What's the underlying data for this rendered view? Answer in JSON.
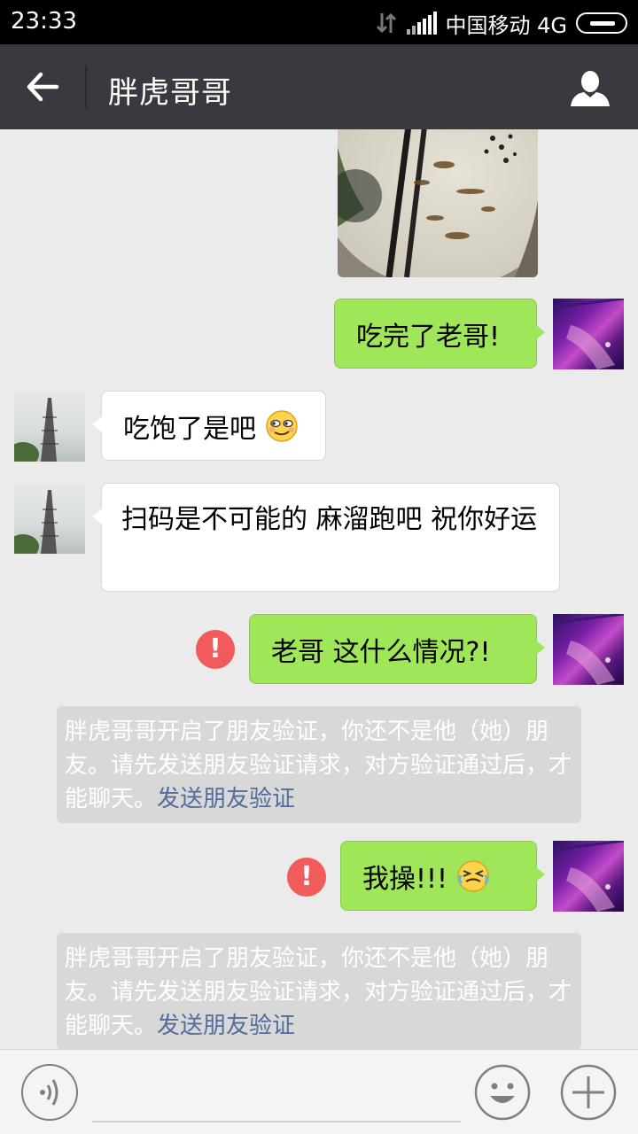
{
  "status_bar": {
    "time": "23:33",
    "carrier": "中国移动 4G"
  },
  "header": {
    "title": "胖虎哥哥"
  },
  "messages": {
    "m1": "吃完了老哥!",
    "m2": "吃饱了是吧",
    "m3": "扫码是不可能的 麻溜跑吧 祝你好运",
    "m4": "老哥 这什么情况?!",
    "m5": "我操!!!"
  },
  "notice": {
    "text": "胖虎哥哥开启了朋友验证，你还不是他（她）朋友。请先发送朋友验证请求，对方验证通过后，才能聊天。",
    "link": "发送朋友验证"
  },
  "error_mark": "!",
  "input": {
    "value": ""
  },
  "icons": {
    "back": "arrow-left-icon",
    "profile": "person-icon",
    "voice": "voice-icon",
    "emoji": "smiley-icon",
    "more": "plus-icon",
    "error": "exclamation-icon"
  },
  "colors": {
    "title_bar": "#393a3f",
    "outgoing_bubble": "#9fe658",
    "incoming_bubble": "#ffffff",
    "error": "#f25b5b",
    "notice_bg": "#d8d8d8",
    "notice_link": "#536c9a"
  }
}
